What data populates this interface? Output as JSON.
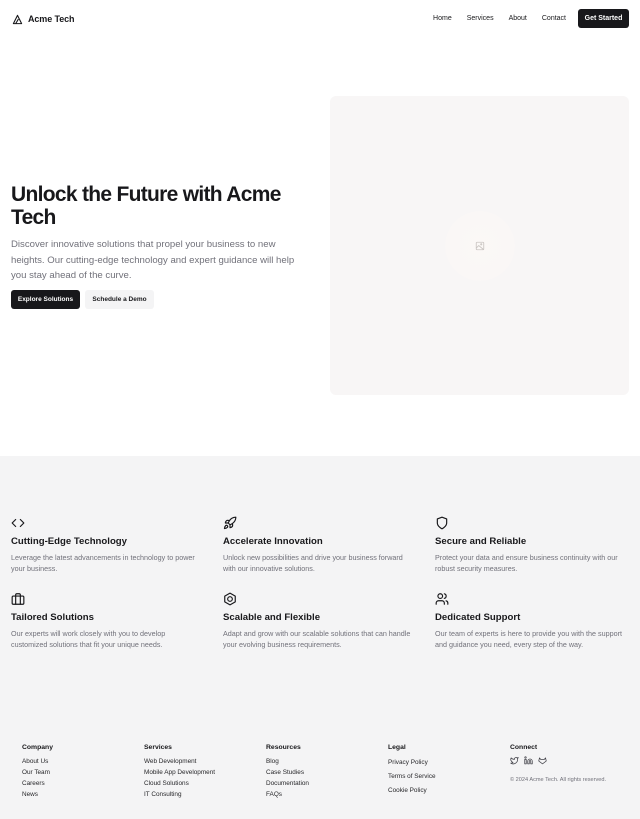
{
  "header": {
    "brand": "Acme Tech",
    "nav": [
      "Home",
      "Services",
      "About",
      "Contact"
    ],
    "cta": "Get Started"
  },
  "hero": {
    "title": "Unlock the Future with Acme Tech",
    "subtitle": "Discover innovative solutions that propel your business to new heights. Our cutting-edge technology and expert guidance will help you stay ahead of the curve.",
    "primary_button": "Explore Solutions",
    "secondary_button": "Schedule a Demo",
    "image_icon": "image-placeholder-icon"
  },
  "features": [
    {
      "icon": "code-icon",
      "title": "Cutting-Edge Technology",
      "desc": "Leverage the latest advancements in technology to power your business."
    },
    {
      "icon": "rocket-icon",
      "title": "Accelerate Innovation",
      "desc": "Unlock new possibilities and drive your business forward with our innovative solutions."
    },
    {
      "icon": "shield-icon",
      "title": "Secure and Reliable",
      "desc": "Protect your data and ensure business continuity with our robust security measures."
    },
    {
      "icon": "briefcase-icon",
      "title": "Tailored Solutions",
      "desc": "Our experts will work closely with you to develop customized solutions that fit your unique needs."
    },
    {
      "icon": "hexagon-nut-icon",
      "title": "Scalable and Flexible",
      "desc": "Adapt and grow with our scalable solutions that can handle your evolving business requirements."
    },
    {
      "icon": "users-icon",
      "title": "Dedicated Support",
      "desc": "Our team of experts is here to provide you with the support and guidance you need, every step of the way."
    }
  ],
  "footer": {
    "company": {
      "title": "Company",
      "links": [
        "About Us",
        "Our Team",
        "Careers",
        "News"
      ]
    },
    "services": {
      "title": "Services",
      "links": [
        "Web Development",
        "Mobile App Development",
        "Cloud Solutions",
        "IT Consulting"
      ]
    },
    "resources": {
      "title": "Resources",
      "links": [
        "Blog",
        "Case Studies",
        "Documentation",
        "FAQs"
      ]
    },
    "legal": {
      "title": "Legal",
      "links": [
        "Privacy Policy",
        "Terms of Service",
        "Cookie Policy"
      ]
    },
    "connect": {
      "title": "Connect",
      "icons": [
        "twitter-icon",
        "linkedin-icon",
        "github-icon"
      ],
      "copyright": "© 2024 Acme Tech. All rights reserved."
    }
  }
}
